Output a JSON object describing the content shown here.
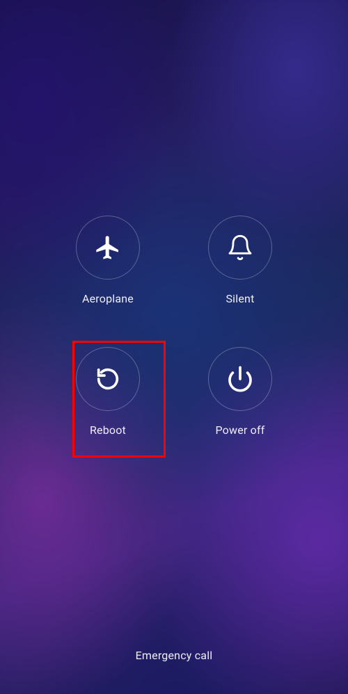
{
  "powerMenu": {
    "options": {
      "aeroplane": {
        "label": "Aeroplane",
        "icon": "airplane-icon"
      },
      "silent": {
        "label": "Silent",
        "icon": "bell-icon"
      },
      "reboot": {
        "label": "Reboot",
        "icon": "reboot-icon"
      },
      "powerOff": {
        "label": "Power off",
        "icon": "power-icon"
      }
    }
  },
  "emergency": {
    "label": "Emergency call"
  },
  "colors": {
    "highlight": "#ff0000",
    "iconStroke": "#ffffff",
    "circleBorder": "rgba(255,255,255,0.28)"
  }
}
